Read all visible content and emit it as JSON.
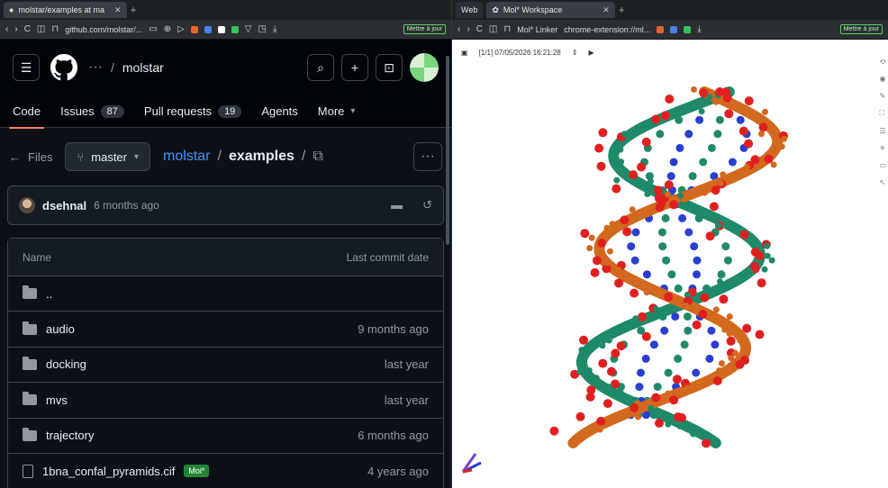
{
  "left_browser": {
    "tab_title": "molstar/examples at ma",
    "url": "github.com/molstar/...",
    "update_label": "Mettre à jour"
  },
  "github": {
    "repo_crumb": "molstar",
    "tabs": [
      {
        "label": "Code"
      },
      {
        "label": "Issues",
        "count": "87"
      },
      {
        "label": "Pull requests",
        "count": "19"
      },
      {
        "label": "Agents"
      },
      {
        "label": "More"
      }
    ],
    "files_label": "Files",
    "branch": "master",
    "path_repo": "molstar",
    "path_dir": "examples",
    "commit": {
      "author": "dsehnal",
      "when": "6 months ago"
    },
    "table_headers": {
      "name": "Name",
      "date": "Last commit date"
    },
    "rows": [
      {
        "name": "..",
        "date": "",
        "type": "folder"
      },
      {
        "name": "audio",
        "date": "9 months ago",
        "type": "folder"
      },
      {
        "name": "docking",
        "date": "last year",
        "type": "folder"
      },
      {
        "name": "mvs",
        "date": "last year",
        "type": "folder"
      },
      {
        "name": "trajectory",
        "date": "6 months ago",
        "type": "folder"
      },
      {
        "name": "1bna_confal_pyramids.cif",
        "date": "4 years ago",
        "type": "file",
        "badge": "Mol*"
      }
    ]
  },
  "right_browser": {
    "web_label": "Web",
    "tab_title": "Mol* Workspace",
    "linker": "Mol* Linker",
    "url": "chrome-extension://ml...",
    "update_label": "Mettre à jour"
  },
  "molstar": {
    "snapshot": "[1/1] 07/05/2026 16:21:28",
    "colors": {
      "backbone": "#d2691e",
      "strand": "#1f8a6a",
      "oxygen": "#e02020",
      "nitrogen": "#2a3fd0"
    }
  }
}
